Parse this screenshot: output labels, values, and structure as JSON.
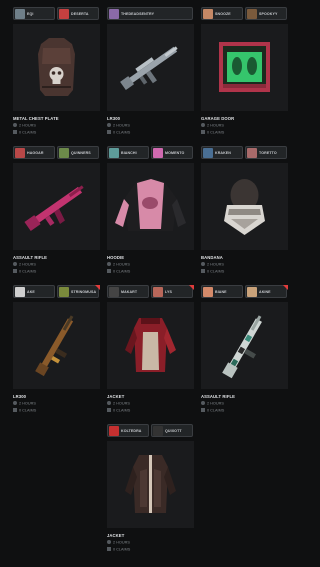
{
  "cards": [
    {
      "title": "METAL CHEST PLATE",
      "chips": [
        "EQI",
        "DESERTA"
      ],
      "hours": "2 HOURS",
      "claims": "0 CLAIMS",
      "avatar_colors": [
        "#6f7f89",
        "#c54040"
      ],
      "flag": false,
      "icon": "chest-plate-icon"
    },
    {
      "title": "LR300",
      "chips": [
        "THEDEADSENTRY"
      ],
      "hours": "2 HOURS",
      "claims": "0 CLAIMS",
      "avatar_colors": [
        "#8b6aa8"
      ],
      "flag": false,
      "icon": "rifle-icon"
    },
    {
      "title": "GARAGE DOOR",
      "chips": [
        "SNOOZE",
        "SPOOKYY"
      ],
      "hours": "2 HOURS",
      "claims": "0 CLAIMS",
      "avatar_colors": [
        "#c48866",
        "#7a5a3c"
      ],
      "flag": false,
      "icon": "garage-door-icon"
    },
    {
      "title": "ASSAULT RIFLE",
      "chips": [
        "HAGGAR",
        "QUINNERS"
      ],
      "hours": "2 HOURS",
      "claims": "0 CLAIMS",
      "avatar_colors": [
        "#b84848",
        "#6c8a4a"
      ],
      "flag": false,
      "icon": "rifle-icon"
    },
    {
      "title": "HOODIE",
      "chips": [
        "BIANCHI",
        "MOMENTO"
      ],
      "hours": "2 HOURS",
      "claims": "0 CLAIMS",
      "avatar_colors": [
        "#5e9c9a",
        "#d06ab0"
      ],
      "flag": false,
      "icon": "hoodie-icon"
    },
    {
      "title": "BANDANA",
      "chips": [
        "KRAKEN",
        "TORETTO"
      ],
      "hours": "2 HOURS",
      "claims": "0 CLAIMS",
      "avatar_colors": [
        "#4a6f94",
        "#a86a6a"
      ],
      "flag": false,
      "icon": "bandana-icon"
    },
    {
      "title": "LR300",
      "chips": [
        "AKE",
        "STRINGMUSA"
      ],
      "hours": "2 HOURS",
      "claims": "0 CLAIMS",
      "avatar_colors": [
        "#cfcfcf",
        "#7a8a3c"
      ],
      "flag": true,
      "icon": "rifle-icon"
    },
    {
      "title": "JACKET",
      "chips": [
        "MAKART",
        "LYS"
      ],
      "hours": "2 HOURS",
      "claims": "0 CLAIMS",
      "avatar_colors": [
        "#444444",
        "#b8675a"
      ],
      "flag": true,
      "icon": "jacket-icon"
    },
    {
      "title": "ASSAULT RIFLE",
      "chips": [
        "BIANE",
        "AKINE"
      ],
      "hours": "2 HOURS",
      "claims": "0 CLAIMS",
      "avatar_colors": [
        "#d48a6a",
        "#c9a27a"
      ],
      "flag": true,
      "icon": "rifle-icon"
    },
    {
      "title": "JACKET",
      "chips": [
        "KOLTEDRA",
        "QUIXOTT"
      ],
      "hours": "2 HOURS",
      "claims": "0 CLAIMS",
      "avatar_colors": [
        "#c43030",
        "#333333"
      ],
      "flag": false,
      "icon": "jacket-icon"
    }
  ]
}
